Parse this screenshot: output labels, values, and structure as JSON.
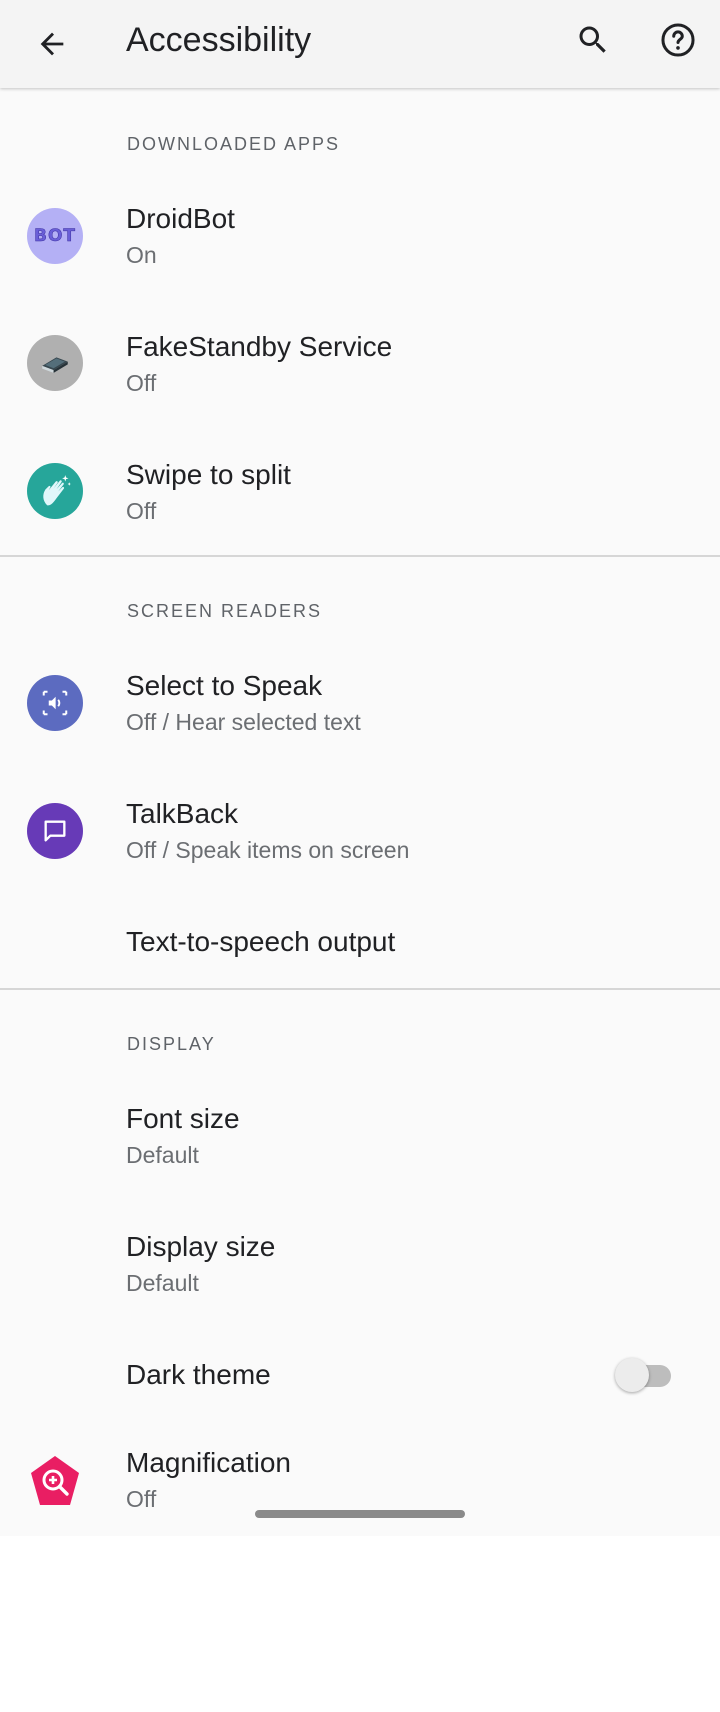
{
  "appbar": {
    "title": "Accessibility",
    "back_icon": "arrow-back-icon",
    "search_icon": "search-icon",
    "help_icon": "help-icon"
  },
  "sections": {
    "downloaded_apps": "DOWNLOADED APPS",
    "screen_readers": "SCREEN READERS",
    "display": "DISPLAY"
  },
  "items": {
    "droidbot": {
      "label": "DroidBot",
      "sub": "On",
      "icon": "droidbot-icon",
      "icon_text": "BOT"
    },
    "fakestandby": {
      "label": "FakeStandby Service",
      "sub": "Off",
      "icon": "book-icon"
    },
    "swipe": {
      "label": "Swipe to split",
      "sub": "Off",
      "icon": "wave-hand-icon"
    },
    "select_to_speak": {
      "label": "Select to Speak",
      "sub": "Off / Hear selected text",
      "icon": "speaker-select-icon"
    },
    "talkback": {
      "label": "TalkBack",
      "sub": "Off / Speak items on screen",
      "icon": "talkback-icon"
    },
    "tts": {
      "label": "Text-to-speech output"
    },
    "font_size": {
      "label": "Font size",
      "sub": "Default"
    },
    "display_size": {
      "label": "Display size",
      "sub": "Default"
    },
    "dark_theme": {
      "label": "Dark theme",
      "toggle_on": false
    },
    "magnification": {
      "label": "Magnification",
      "sub": "Off",
      "icon": "magnification-icon"
    }
  },
  "colors": {
    "droidbot_bg": "#b4b0f5",
    "fakestandby_bg": "#b0b0b0",
    "swipe_bg": "#26a69a",
    "select_to_speak_bg": "#5c6bc0",
    "talkback_bg": "#673ab7",
    "magnification_bg": "#e91e63"
  }
}
